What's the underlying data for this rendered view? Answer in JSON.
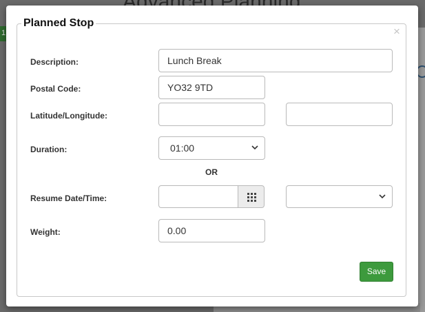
{
  "background": {
    "page_title": "Advanced Planning",
    "side_badge": "1"
  },
  "dialog": {
    "title": "Planned Stop",
    "close_glyph": "×",
    "fields": {
      "description": {
        "label": "Description:",
        "value": "Lunch Break"
      },
      "postal_code": {
        "label": "Postal Code:",
        "value": "YO32 9TD"
      },
      "lat_lng": {
        "label": "Latitude/Longitude:",
        "latitude": "",
        "longitude": ""
      },
      "duration": {
        "label": "Duration:",
        "value": "01:00"
      },
      "or_text": "OR",
      "resume": {
        "label": "Resume Date/Time:",
        "date": "",
        "time": ""
      },
      "weight": {
        "label": "Weight:",
        "value": "0.00"
      }
    },
    "save_label": "Save"
  },
  "colors": {
    "save_button": "#3d9a3d",
    "close_icon": "#c5c5c5"
  },
  "icons": {
    "close": "close-icon",
    "calendar": "calendar-grid-icon",
    "dropdown": "chevron-down-icon"
  }
}
